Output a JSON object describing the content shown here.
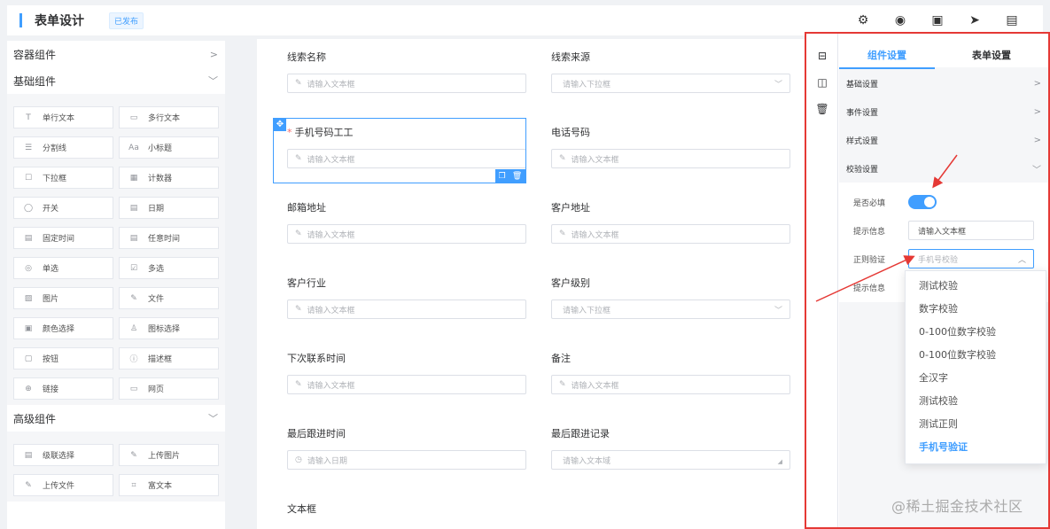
{
  "header": {
    "title": "表单设计",
    "status_badge": "已发布",
    "icons": [
      "gear-icon",
      "eye-icon",
      "save-icon",
      "send-icon",
      "document-icon"
    ]
  },
  "sidebar": {
    "groups": [
      {
        "label": "容器组件",
        "expanded": false,
        "items": []
      },
      {
        "label": "基础组件",
        "expanded": true,
        "items": [
          {
            "label": "单行文本",
            "icon": "text-icon"
          },
          {
            "label": "多行文本",
            "icon": "textarea-icon"
          },
          {
            "label": "分割线",
            "icon": "divider-icon"
          },
          {
            "label": "小标题",
            "icon": "subtitle-icon"
          },
          {
            "label": "下拉框",
            "icon": "select-icon"
          },
          {
            "label": "计数器",
            "icon": "counter-icon"
          },
          {
            "label": "开关",
            "icon": "switch-icon"
          },
          {
            "label": "日期",
            "icon": "date-icon"
          },
          {
            "label": "固定时间",
            "icon": "time-icon"
          },
          {
            "label": "任意时间",
            "icon": "anytime-icon"
          },
          {
            "label": "单选",
            "icon": "radio-icon"
          },
          {
            "label": "多选",
            "icon": "checkbox-icon"
          },
          {
            "label": "图片",
            "icon": "image-icon"
          },
          {
            "label": "文件",
            "icon": "file-icon"
          },
          {
            "label": "颜色选择",
            "icon": "color-icon"
          },
          {
            "label": "图标选择",
            "icon": "iconpicker-icon"
          },
          {
            "label": "按钮",
            "icon": "button-icon"
          },
          {
            "label": "描述框",
            "icon": "info-icon"
          },
          {
            "label": "链接",
            "icon": "link-icon"
          },
          {
            "label": "网页",
            "icon": "webpage-icon"
          }
        ]
      },
      {
        "label": "高级组件",
        "expanded": true,
        "items": [
          {
            "label": "级联选择",
            "icon": "cascade-icon"
          },
          {
            "label": "上传图片",
            "icon": "upload-image-icon"
          },
          {
            "label": "上传文件",
            "icon": "upload-file-icon"
          },
          {
            "label": "富文本",
            "icon": "richtext-icon"
          }
        ]
      }
    ]
  },
  "form": {
    "fields": [
      {
        "label": "线索名称",
        "placeholder": "请输入文本框",
        "kind": "text"
      },
      {
        "label": "线索来源",
        "placeholder": "请输入下拉框",
        "kind": "select"
      },
      {
        "label": "手机号码工工",
        "placeholder": "请输入文本框",
        "kind": "text",
        "required": true,
        "selected": true
      },
      {
        "label": "电话号码",
        "placeholder": "请输入文本框",
        "kind": "text"
      },
      {
        "label": "邮箱地址",
        "placeholder": "请输入文本框",
        "kind": "text"
      },
      {
        "label": "客户地址",
        "placeholder": "请输入文本框",
        "kind": "text"
      },
      {
        "label": "客户行业",
        "placeholder": "请输入文本框",
        "kind": "text"
      },
      {
        "label": "客户级别",
        "placeholder": "请输入下拉框",
        "kind": "select"
      },
      {
        "label": "下次联系时间",
        "placeholder": "请输入文本框",
        "kind": "text"
      },
      {
        "label": "备注",
        "placeholder": "请输入文本框",
        "kind": "text"
      },
      {
        "label": "最后跟进时间",
        "placeholder": "请输入日期",
        "kind": "date"
      },
      {
        "label": "最后跟进记录",
        "placeholder": "请输入文本域",
        "kind": "textarea"
      },
      {
        "label": "文本框",
        "placeholder": "",
        "kind": "text"
      }
    ]
  },
  "panel": {
    "tabs": [
      "组件设置",
      "表单设置"
    ],
    "active_tab": "组件设置",
    "sections": [
      "基础设置",
      "事件设置",
      "样式设置",
      "校验设置"
    ],
    "validation": {
      "required_label": "是否必填",
      "required_on": true,
      "hint_label": "提示信息",
      "hint_value": "请输入文本框",
      "regex_label": "正则验证",
      "regex_placeholder": "手机号校验",
      "hint2_label": "提示信息"
    },
    "regex_options": [
      "测试校验",
      "数字校验",
      "0-100位数字校验",
      "0-100位数字校验",
      "全汉字",
      "测试校验",
      "测试正则",
      "手机号验证"
    ],
    "regex_selected": "手机号验证"
  },
  "watermark": "@稀土掘金技术社区",
  "colors": {
    "accent": "#409eff",
    "highlight_border": "#e53935",
    "required": "#f56c6c"
  }
}
